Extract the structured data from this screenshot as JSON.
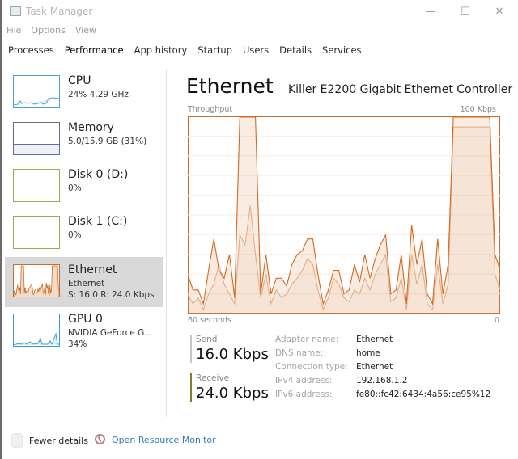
{
  "window": {
    "title": "Task Manager",
    "controls": {
      "minimize": "—",
      "maximize": "☐",
      "close": "✕"
    }
  },
  "menu": [
    "File",
    "Options",
    "View"
  ],
  "tabs": [
    {
      "label": "Processes",
      "active": false
    },
    {
      "label": "Performance",
      "active": true
    },
    {
      "label": "App history",
      "active": false
    },
    {
      "label": "Startup",
      "active": false
    },
    {
      "label": "Users",
      "active": false
    },
    {
      "label": "Details",
      "active": false
    },
    {
      "label": "Services",
      "active": false
    }
  ],
  "sidebar": {
    "items": [
      {
        "title": "CPU",
        "lines": [
          "24% 4.29 GHz"
        ],
        "color": "#4aa3cf",
        "active": false
      },
      {
        "title": "Memory",
        "lines": [
          "5.0/15.9 GB (31%)"
        ],
        "color": "#6a6a9a",
        "active": false
      },
      {
        "title": "Disk 0 (D:)",
        "lines": [
          "0%"
        ],
        "color": "#a6a64a",
        "active": false
      },
      {
        "title": "Disk 1 (C:)",
        "lines": [
          "0%"
        ],
        "color": "#a6a64a",
        "active": false
      },
      {
        "title": "Ethernet",
        "lines": [
          "Ethernet",
          "S: 16.0  R: 24.0 Kbps"
        ],
        "color": "#c86d2a",
        "active": true
      },
      {
        "title": "GPU 0",
        "lines": [
          "NVIDIA GeForce G...",
          "34%"
        ],
        "color": "#3a9bd1",
        "active": false
      }
    ]
  },
  "main": {
    "title": "Ethernet",
    "adapter": "Killer E2200 Gigabit Ethernet Controller",
    "graph": {
      "label_top_left": "Throughput",
      "label_top_right": "100 Kbps",
      "label_bottom_left": "60 seconds",
      "label_bottom_right": "0"
    },
    "send": {
      "label": "Send",
      "value": "16.0 Kbps",
      "color": "#bdbdbd"
    },
    "receive": {
      "label": "Receive",
      "value": "24.0 Kbps",
      "color": "#8a7a2a"
    },
    "properties": [
      {
        "key": "Adapter name:",
        "value": "Ethernet"
      },
      {
        "key": "DNS name:",
        "value": "home"
      },
      {
        "key": "Connection type:",
        "value": "Ethernet"
      },
      {
        "key": "IPv4 address:",
        "value": "192.168.1.2"
      },
      {
        "key": "IPv6 address:",
        "value": "fe80::fc42:6434:4a56:ce95%12"
      }
    ]
  },
  "footer": {
    "fewer_details": "Fewer details",
    "resource_monitor": "Open Resource Monitor"
  },
  "chart_data": {
    "type": "line",
    "title": "Throughput",
    "xlabel": "60 seconds",
    "ylabel": "Kbps",
    "xlim": [
      60,
      0
    ],
    "ylim": [
      0,
      100
    ],
    "x": [
      60,
      59,
      58,
      57,
      56,
      55,
      54,
      53,
      52,
      51,
      50,
      49,
      48,
      47,
      46,
      45,
      44,
      43,
      42,
      41,
      40,
      39,
      38,
      37,
      36,
      35,
      34,
      33,
      32,
      31,
      30,
      29,
      28,
      27,
      26,
      25,
      24,
      23,
      22,
      21,
      20,
      19,
      18,
      17,
      16,
      15,
      14,
      13,
      12,
      11,
      10,
      9,
      8,
      7,
      6,
      5,
      4,
      3,
      2,
      1,
      0
    ],
    "series": [
      {
        "name": "Receive",
        "color": "#d46a1f",
        "values": [
          20,
          12,
          12,
          5,
          22,
          38,
          22,
          18,
          30,
          8,
          100,
          100,
          100,
          100,
          10,
          30,
          10,
          18,
          18,
          14,
          25,
          30,
          32,
          38,
          38,
          20,
          5,
          12,
          22,
          22,
          10,
          12,
          25,
          16,
          30,
          18,
          28,
          35,
          40,
          10,
          12,
          30,
          5,
          45,
          25,
          38,
          10,
          5,
          38,
          10,
          25,
          100,
          100,
          100,
          100,
          100,
          100,
          100,
          100,
          30,
          22
        ]
      },
      {
        "name": "Send",
        "color": "#e8b99a",
        "values": [
          10,
          5,
          8,
          2,
          10,
          15,
          25,
          15,
          10,
          5,
          40,
          35,
          55,
          30,
          8,
          20,
          5,
          12,
          8,
          10,
          15,
          18,
          22,
          28,
          25,
          12,
          2,
          8,
          18,
          15,
          8,
          6,
          12,
          10,
          18,
          12,
          20,
          25,
          30,
          6,
          8,
          18,
          2,
          30,
          15,
          25,
          5,
          2,
          25,
          5,
          15,
          95,
          95,
          95,
          95,
          95,
          95,
          95,
          95,
          20,
          12
        ]
      }
    ]
  }
}
